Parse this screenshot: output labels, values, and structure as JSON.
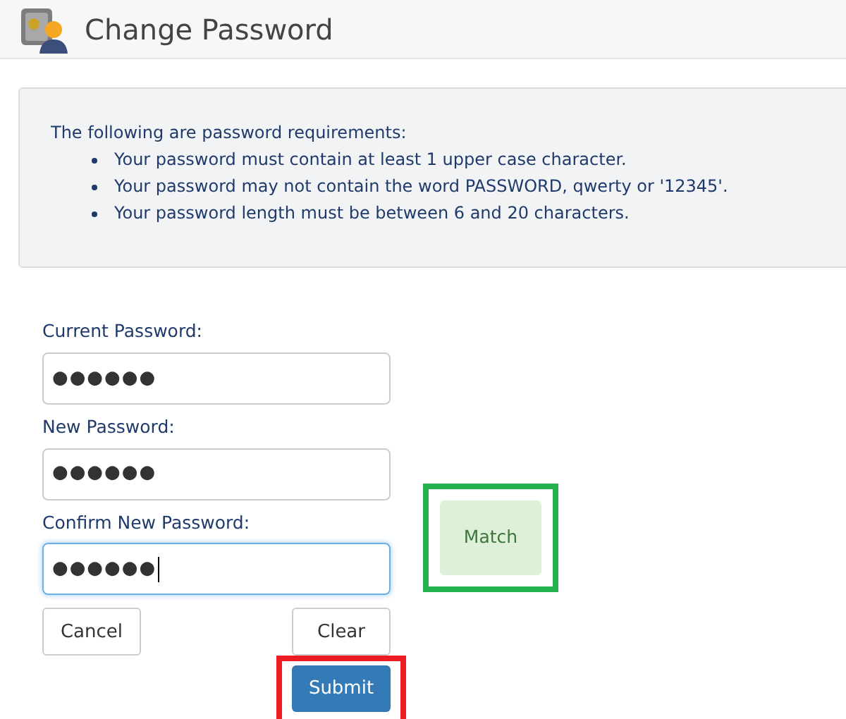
{
  "header": {
    "title": "Change Password"
  },
  "requirements": {
    "intro": "The following are password requirements:",
    "items": [
      "Your password must contain at least 1 upper case character.",
      "Your password may not contain the word PASSWORD, qwerty or '12345'.",
      "Your password length must be between 6 and 20 characters."
    ]
  },
  "fields": [
    {
      "label": "Current Password:",
      "value": "●●●●●●",
      "focused": false
    },
    {
      "label": "New Password:",
      "value": "●●●●●●",
      "focused": false
    },
    {
      "label": "Confirm New Password:",
      "value": "●●●●●●",
      "focused": true
    }
  ],
  "match_indicator": {
    "text": "Match"
  },
  "buttons": {
    "cancel": "Cancel",
    "clear": "Clear",
    "submit": "Submit"
  },
  "annotations": [
    {
      "kind": "match",
      "color": "#22b14c"
    },
    {
      "kind": "submit",
      "color": "#ed1c24"
    }
  ]
}
